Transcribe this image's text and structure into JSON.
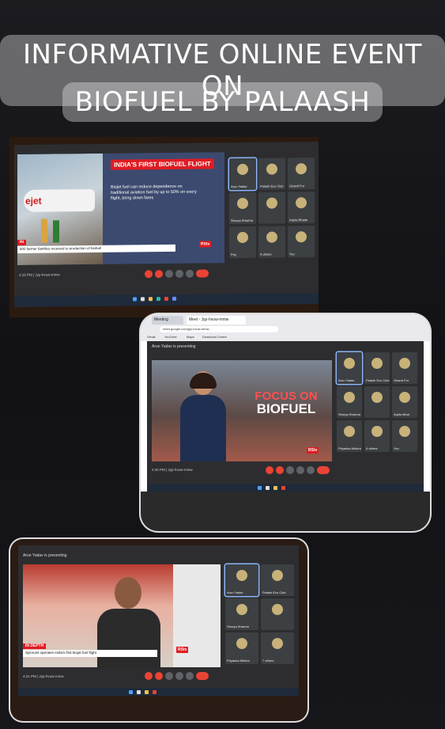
{
  "story": {
    "caption_line1": "INFORMATIVE ONLINE EVENT ON",
    "caption_line2": "BIOFUEL BY PALAASH"
  },
  "photo1": {
    "slide_title": "INDIA'S FIRST BIOFUEL FLIGHT",
    "slide_bullet": "Biojet fuel can reduce dependence on traditional aviation fuel by up to 50% on every flight, bring down fares",
    "ticker_tag": "IN",
    "ticker_text": "500 farmer families received to production of biofuel",
    "channel_logo": "RStv",
    "clock": "4:15 PM  |  Jyp-hvuw-mmw",
    "participants": [
      {
        "name": "Arun Yadav"
      },
      {
        "name": "Palash Eco Club"
      },
      {
        "name": "Girand Fur"
      },
      {
        "name": "Shreya Sharma"
      },
      {
        "name": ""
      },
      {
        "name": "Arpita Bhatia"
      },
      {
        "name": "Priy"
      },
      {
        "name": "4 others"
      },
      {
        "name": "You"
      }
    ]
  },
  "photo2": {
    "tab1": "Meeting",
    "tab2": "Meet - Jyp-hvuw-mmw",
    "url": "meet.google.com/jyp-hvuw-mmw",
    "bookmarks": [
      "Gmail",
      "YouTube",
      "Maps",
      "Download Centre"
    ],
    "presenting": "Arun Yadav is presenting",
    "focus_line1": "FOCUS ON",
    "focus_line2": "BIOFUEL",
    "channel_logo": "RStv",
    "clock": "4:20 PM  |  Jyp-hvuw-mmw",
    "participants": [
      {
        "name": "Arun Yadav"
      },
      {
        "name": "Palash Eco Club"
      },
      {
        "name": "Girand Fur"
      },
      {
        "name": "Shreya Sharma"
      },
      {
        "name": ""
      },
      {
        "name": "Arpita Bhat"
      },
      {
        "name": "Priyanka Mishra"
      },
      {
        "name": "4 others"
      },
      {
        "name": "You"
      }
    ]
  },
  "photo3": {
    "presenting": "Arun Yadav is presenting",
    "ticker_tag": "IN DEPTH",
    "ticker_text": "SpiceJet operates India's first biojet fuel flight",
    "channel_logo": "RStv",
    "clock": "4:21 PM  |  Jyp-hvuw-mmw",
    "participants": [
      {
        "name": "Arun Yadav"
      },
      {
        "name": "Palash Eco Club"
      },
      {
        "name": "Shreya Sharma"
      },
      {
        "name": ""
      },
      {
        "name": "Priyanka Mishra"
      },
      {
        "name": "7 others"
      }
    ]
  },
  "colors": {
    "meet_active_border": "#8ab4f8",
    "end_call": "#ea4335",
    "rstv_red": "#e01b22"
  }
}
